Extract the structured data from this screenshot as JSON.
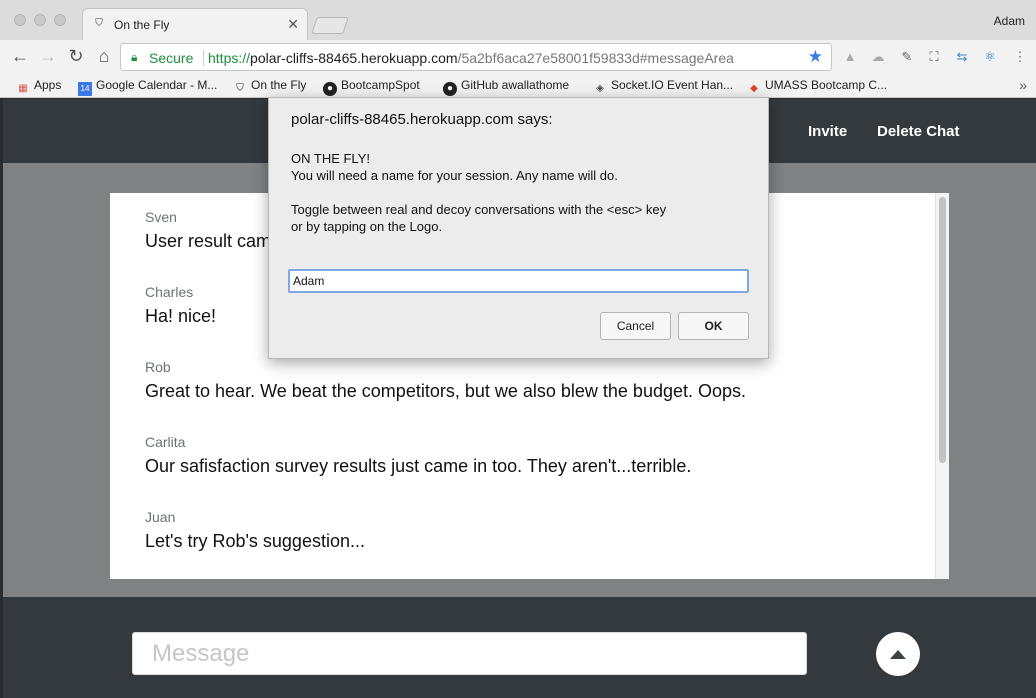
{
  "browser": {
    "tab": {
      "title": "On the Fly",
      "close": "✕"
    },
    "profile_name": "Adam",
    "omnibox": {
      "secure_label": "Secure",
      "url_scheme": "https://",
      "url_host": "polar-cliffs-88465.herokuapp.com",
      "url_path": "/5a2bf6aca27e58001f59833d#messageArea"
    },
    "bookmarks": [
      {
        "label": "Apps",
        "icon": "apps-grid-icon"
      },
      {
        "label": "Google Calendar - M...",
        "icon": "calendar-icon",
        "icon_text": "14"
      },
      {
        "label": "On the Fly",
        "icon": "shield-icon"
      },
      {
        "label": "BootcampSpot",
        "icon": "github-icon"
      },
      {
        "label": "GitHub awallathome",
        "icon": "github-icon"
      },
      {
        "label": "Socket.IO Event Han...",
        "icon": "socketio-icon"
      },
      {
        "label": "UMASS Bootcamp C...",
        "icon": "gitlab-icon"
      }
    ],
    "bookmarks_more": "»"
  },
  "header": {
    "invite_label": "Invite",
    "delete_chat_label": "Delete Chat"
  },
  "messages": [
    {
      "author": "Sven",
      "text": "User result cam"
    },
    {
      "author": "Charles",
      "text": "Ha! nice!"
    },
    {
      "author": "Rob",
      "text": "Great to hear. We beat the competitors, but we also blew the budget. Oops."
    },
    {
      "author": "Carlita",
      "text": "Our safisfaction survey results just came in too. They aren't...terrible."
    },
    {
      "author": "Juan",
      "text": "Let's try Rob's suggestion..."
    }
  ],
  "composer": {
    "placeholder": "Message"
  },
  "dialog": {
    "title": "polar-cliffs-88465.herokuapp.com says:",
    "lines": [
      "ON THE FLY!",
      "You will need a name for your session. Any name will do.",
      "Toggle between real and decoy conversations with the <esc> key",
      "or by tapping on the Logo."
    ],
    "input_value": "Adam",
    "cancel_label": "Cancel",
    "ok_label": "OK"
  },
  "colors": {
    "header_bg": "#34393e",
    "chat_backdrop": "#7f8183",
    "secure_green": "#1e8e3e",
    "focus_blue": "#7fa7e6"
  }
}
